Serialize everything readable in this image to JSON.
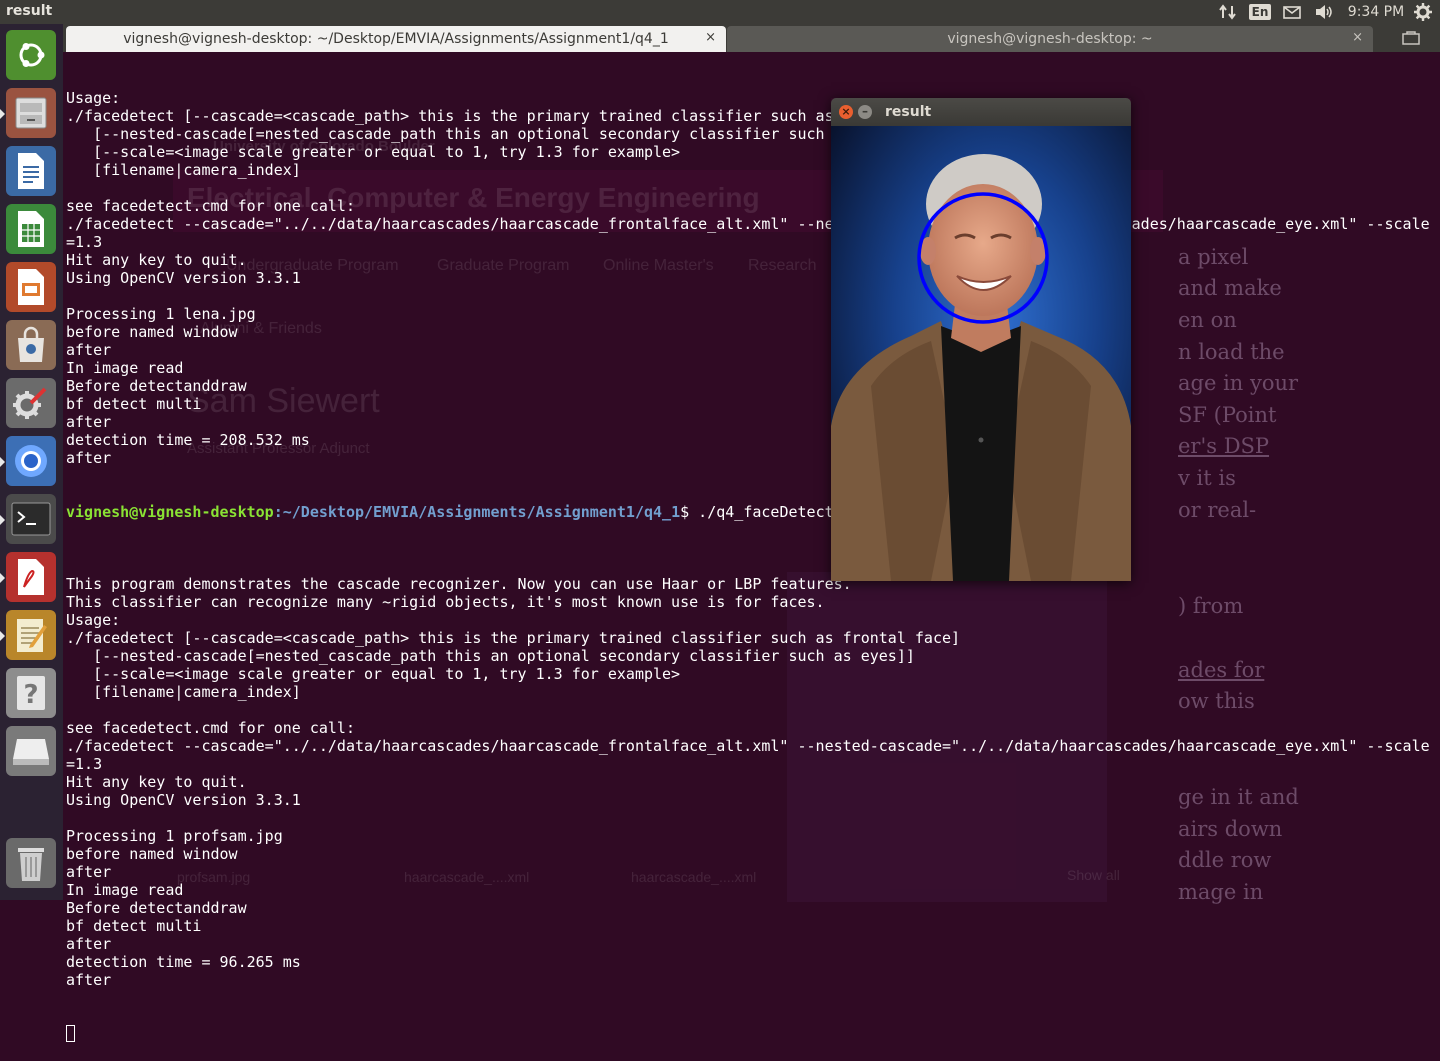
{
  "panel": {
    "title": "result",
    "keyboard_layout": "En",
    "clock": "9:34 PM"
  },
  "launcher": {
    "items": [
      {
        "name": "ubuntu-dash",
        "icon": "ubuntu-logo-icon"
      },
      {
        "name": "files",
        "icon": "file-cabinet-icon"
      },
      {
        "name": "libreoffice-writer",
        "icon": "writer-document-icon"
      },
      {
        "name": "libreoffice-calc",
        "icon": "calc-spreadsheet-icon"
      },
      {
        "name": "libreoffice-impress",
        "icon": "impress-presentation-icon"
      },
      {
        "name": "software-center",
        "icon": "shopping-bag-icon"
      },
      {
        "name": "system-settings",
        "icon": "gear-wrench-icon"
      },
      {
        "name": "chromium",
        "icon": "chromium-icon"
      },
      {
        "name": "terminal",
        "icon": "terminal-icon"
      },
      {
        "name": "document-viewer",
        "icon": "pdf-viewer-icon"
      },
      {
        "name": "text-editor",
        "icon": "notepad-icon"
      },
      {
        "name": "help",
        "icon": "question-mark-icon"
      },
      {
        "name": "scanner",
        "icon": "scanner-icon"
      },
      {
        "name": "trash",
        "icon": "trash-icon"
      }
    ]
  },
  "terminal": {
    "tabs": [
      {
        "title": "vignesh@vignesh-desktop: ~/Desktop/EMVIA/Assignments/Assignment1/q4_1",
        "close": "×"
      },
      {
        "title": "vignesh@vignesh-desktop: ~",
        "close": "×"
      }
    ],
    "prompt_user": "vignesh@vignesh-desktop",
    "prompt_path": ":~/Desktop/EMVIA/Assignments/Assignment1/q4_1",
    "prompt_command": "$ ./q4_faceDetect",
    "lines_before": [
      "Usage:",
      "./facedetect [--cascade=<cascade_path> this is the primary trained classifier such as frontal face]",
      "   [--nested-cascade[=nested_cascade_path this an optional secondary classifier such as eyes]]",
      "   [--scale=<image scale greater or equal to 1, try 1.3 for example>",
      "   [filename|camera_index]",
      "",
      "see facedetect.cmd for one call:",
      "./facedetect --cascade=\"../../data/haarcascades/haarcascade_frontalface_alt.xml\" --nested-cascade=\"../../data/haarcascades/haarcascade_eye.xml\" --scale",
      "=1.3",
      "Hit any key to quit.",
      "Using OpenCV version 3.3.1",
      "",
      "Processing 1 lena.jpg",
      "before named window",
      "after",
      "In image read",
      "Before detectanddraw",
      "bf detect multi",
      "after",
      "detection time = 208.532 ms",
      "after"
    ],
    "lines_after": [
      "",
      "This program demonstrates the cascade recognizer. Now you can use Haar or LBP features.",
      "This classifier can recognize many ~rigid objects, it's most known use is for faces.",
      "Usage:",
      "./facedetect [--cascade=<cascade_path> this is the primary trained classifier such as frontal face]",
      "   [--nested-cascade[=nested_cascade_path this an optional secondary classifier such as eyes]]",
      "   [--scale=<image scale greater or equal to 1, try 1.3 for example>",
      "   [filename|camera_index]",
      "",
      "see facedetect.cmd for one call:",
      "./facedetect --cascade=\"../../data/haarcascades/haarcascade_frontalface_alt.xml\" --nested-cascade=\"../../data/haarcascades/haarcascade_eye.xml\" --scale",
      "=1.3",
      "Hit any key to quit.",
      "Using OpenCV version 3.3.1",
      "",
      "Processing 1 profsam.jpg",
      "before named window",
      "after",
      "In image read",
      "Before detectanddraw",
      "bf detect multi",
      "after",
      "detection time = 96.265 ms",
      "after"
    ]
  },
  "result_window": {
    "title": "result",
    "close_glyph": "×",
    "minimize_glyph": "–"
  },
  "background_browser": {
    "university": "University of Colorado Boulder",
    "department": "Electrical, Computer & Energy Engineering",
    "nav": [
      "Undergraduate Program",
      "Graduate Program",
      "Online Master's",
      "Research"
    ],
    "nav2": "Alumni & Friends",
    "person_name": "Sam Siewert",
    "person_role": "Assistant Professor Adjunct",
    "downloads": [
      "profsam.jpg",
      "haarcascade_....xml",
      "haarcascade_....xml"
    ],
    "show_all": "Show all",
    "body_fragments": [
      "a pixel",
      "and make",
      "en on",
      "n load the",
      "age in your",
      "SF (Point",
      "er's DSP",
      "v it is",
      "or real-",
      ") from",
      "ades for",
      "ow this",
      "ge in it and",
      "airs down",
      "ddle row",
      "mage in"
    ]
  },
  "colors": {
    "terminal_bg": "#300a24",
    "prompt_user": "#8ae234",
    "prompt_path": "#729fcf",
    "panel_bg": "#3c3b37",
    "detection_circle": "#0000ff"
  }
}
